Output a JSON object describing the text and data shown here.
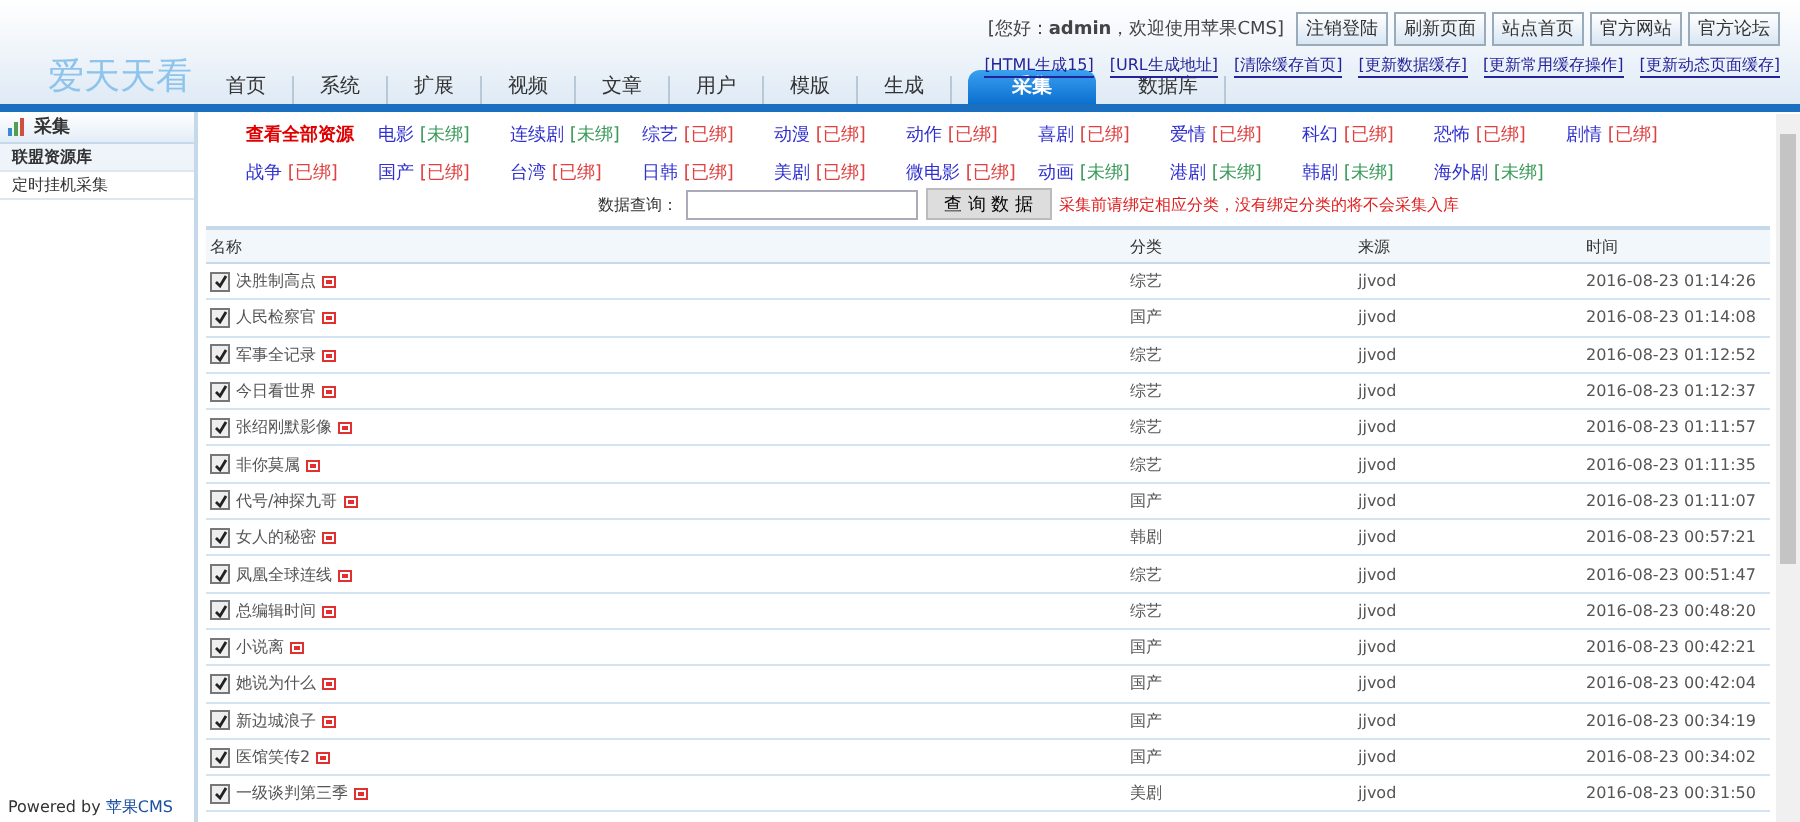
{
  "header": {
    "logo": "爱天天看",
    "greeting": "[您好：**admin**，欢迎使用苹果CMS]",
    "buttons": [
      "注销登陆",
      "刷新页面",
      "站点首页",
      "官方网站",
      "官方论坛"
    ],
    "links": [
      "[HTML生成15]",
      "[URL生成地址]",
      "[清除缓存首页]",
      "[更新数据缓存]",
      "[更新常用缓存操作]",
      "[更新动态页面缓存]"
    ],
    "tabs": [
      {
        "label": "首页",
        "selected": false
      },
      {
        "label": "系统",
        "selected": false
      },
      {
        "label": "扩展",
        "selected": false
      },
      {
        "label": "视频",
        "selected": false
      },
      {
        "label": "文章",
        "selected": false
      },
      {
        "label": "用户",
        "selected": false
      },
      {
        "label": "模版",
        "selected": false
      },
      {
        "label": "生成",
        "selected": false
      },
      {
        "label": "采集",
        "selected": true
      },
      {
        "label": "数据库",
        "selected": false
      }
    ]
  },
  "sidebar": {
    "title": "采集",
    "items": [
      {
        "label": "联盟资源库",
        "selected": true
      },
      {
        "label": "定时挂机采集",
        "selected": false
      }
    ],
    "footer": "Powered by ",
    "footer_link": "苹果CMS"
  },
  "all_link": "查看全部资源",
  "bindings": [
    {
      "name": "电影",
      "status": "[未绑]",
      "bound": false
    },
    {
      "name": "连续剧",
      "status": "[未绑]",
      "bound": false
    },
    {
      "name": "综艺",
      "status": "[已绑]",
      "bound": true
    },
    {
      "name": "动漫",
      "status": "[已绑]",
      "bound": true
    },
    {
      "name": "动作",
      "status": "[已绑]",
      "bound": true
    },
    {
      "name": "喜剧",
      "status": "[已绑]",
      "bound": true
    },
    {
      "name": "爱情",
      "status": "[已绑]",
      "bound": true
    },
    {
      "name": "科幻",
      "status": "[已绑]",
      "bound": true
    },
    {
      "name": "恐怖",
      "status": "[已绑]",
      "bound": true
    },
    {
      "name": "剧情",
      "status": "[已绑]",
      "bound": true
    },
    {
      "name": "战争",
      "status": "[已绑]",
      "bound": true
    },
    {
      "name": "国产",
      "status": "[已绑]",
      "bound": true
    },
    {
      "name": "台湾",
      "status": "[已绑]",
      "bound": true
    },
    {
      "name": "日韩",
      "status": "[已绑]",
      "bound": true
    },
    {
      "name": "美剧",
      "status": "[已绑]",
      "bound": true
    },
    {
      "name": "微电影",
      "status": "[已绑]",
      "bound": true
    },
    {
      "name": "动画",
      "status": "[未绑]",
      "bound": false
    },
    {
      "name": "港剧",
      "status": "[未绑]",
      "bound": false
    },
    {
      "name": "韩剧",
      "status": "[未绑]",
      "bound": false
    },
    {
      "name": "海外剧",
      "status": "[未绑]",
      "bound": false
    }
  ],
  "search": {
    "label": "数据查询：",
    "button": "查 询 数 据",
    "note": "采集前请绑定相应分类，没有绑定分类的将不会采集入库"
  },
  "table": {
    "columns": [
      "名称",
      "分类",
      "来源",
      "时间"
    ],
    "rows": [
      {
        "name": "决胜制高点",
        "category": "综艺",
        "source": "jjvod",
        "time": "2016-08-23 01:14:26",
        "checked": true
      },
      {
        "name": "人民检察官",
        "category": "国产",
        "source": "jjvod",
        "time": "2016-08-23 01:14:08",
        "checked": true
      },
      {
        "name": "军事全记录",
        "category": "综艺",
        "source": "jjvod",
        "time": "2016-08-23 01:12:52",
        "checked": true
      },
      {
        "name": "今日看世界",
        "category": "综艺",
        "source": "jjvod",
        "time": "2016-08-23 01:12:37",
        "checked": true
      },
      {
        "name": "张绍刚默影像",
        "category": "综艺",
        "source": "jjvod",
        "time": "2016-08-23 01:11:57",
        "checked": true
      },
      {
        "name": "非你莫属",
        "category": "综艺",
        "source": "jjvod",
        "time": "2016-08-23 01:11:35",
        "checked": true
      },
      {
        "name": "代号/神探九哥",
        "category": "国产",
        "source": "jjvod",
        "time": "2016-08-23 01:11:07",
        "checked": true
      },
      {
        "name": "女人的秘密",
        "category": "韩剧",
        "source": "jjvod",
        "time": "2016-08-23 00:57:21",
        "checked": true
      },
      {
        "name": "凤凰全球连线",
        "category": "综艺",
        "source": "jjvod",
        "time": "2016-08-23 00:51:47",
        "checked": true
      },
      {
        "name": "总编辑时间",
        "category": "综艺",
        "source": "jjvod",
        "time": "2016-08-23 00:48:20",
        "checked": true
      },
      {
        "name": "小说离",
        "category": "国产",
        "source": "jjvod",
        "time": "2016-08-23 00:42:21",
        "checked": true
      },
      {
        "name": "她说为什么",
        "category": "国产",
        "source": "jjvod",
        "time": "2016-08-23 00:42:04",
        "checked": true
      },
      {
        "name": "新边城浪子",
        "category": "国产",
        "source": "jjvod",
        "time": "2016-08-23 00:34:19",
        "checked": true
      },
      {
        "name": "医馆笑传2",
        "category": "国产",
        "source": "jjvod",
        "time": "2016-08-23 00:34:02",
        "checked": true
      },
      {
        "name": "一级谈判第三季",
        "category": "美剧",
        "source": "jjvod",
        "time": "2016-08-23 00:31:50",
        "checked": true
      }
    ]
  }
}
